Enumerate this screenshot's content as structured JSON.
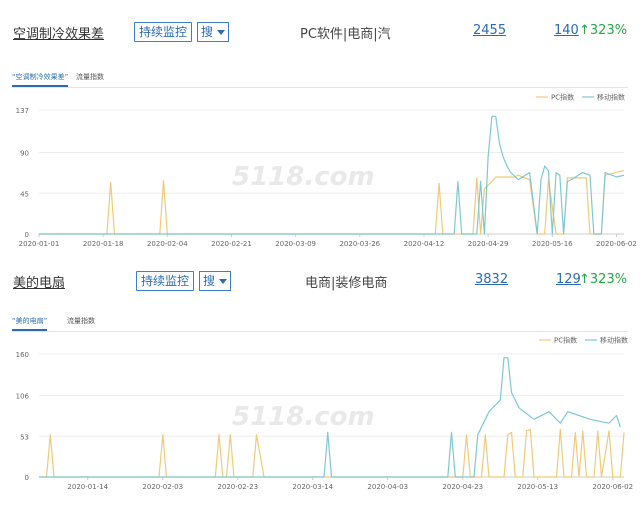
{
  "rows": [
    {
      "keyword": "空调制冷效果差",
      "monitor_label": "持续监控",
      "search_label": "搜",
      "category": "PC软件|电商|汽",
      "count": "2455",
      "rank": "140",
      "growth": "323%",
      "tab_keyword": "“空调制冷效果差”",
      "tab_metric": "流量指数"
    },
    {
      "keyword": "美的电扇",
      "monitor_label": "持续监控",
      "search_label": "搜",
      "category": "电商|装修电商",
      "count": "3832",
      "rank": "129",
      "growth": "323%",
      "tab_keyword": "“美的电扇”",
      "tab_metric": "流量指数"
    }
  ],
  "watermark": "5118.com",
  "colors": {
    "pc": "#f0c97a",
    "mobile": "#7fc8d0",
    "accent": "#2b6cb0",
    "growth": "#28a745"
  },
  "icons": {
    "growth": "arrow-up-icon",
    "search_caret": "chevron-down-icon"
  },
  "chart_data": [
    {
      "type": "line",
      "x_range": [
        "2020-01-01",
        "2020-06-04"
      ],
      "x_ticks": [
        "2020-01-01",
        "2020-01-18",
        "2020-02-04",
        "2020-02-21",
        "2020-03-09",
        "2020-03-26",
        "2020-04-12",
        "2020-04-29",
        "2020-05-16",
        "2020-06-02"
      ],
      "y_ticks": [
        "0",
        "45",
        "90",
        "137"
      ],
      "ylim": [
        0,
        137
      ],
      "legend": [
        "PC指数",
        "移动指数"
      ],
      "legend_position": "top-right",
      "grid": true,
      "series": [
        {
          "name": "PC指数",
          "color": "#f0c97a",
          "points": [
            [
              "2020-01-01",
              0
            ],
            [
              "2020-01-19",
              0
            ],
            [
              "2020-01-20",
              57
            ],
            [
              "2020-01-21",
              0
            ],
            [
              "2020-02-02",
              0
            ],
            [
              "2020-02-03",
              59
            ],
            [
              "2020-02-04",
              0
            ],
            [
              "2020-04-15",
              0
            ],
            [
              "2020-04-16",
              56
            ],
            [
              "2020-04-17",
              0
            ],
            [
              "2020-04-25",
              0
            ],
            [
              "2020-04-26",
              62
            ],
            [
              "2020-04-27",
              0
            ],
            [
              "2020-04-28",
              50
            ],
            [
              "2020-04-30",
              58
            ],
            [
              "2020-05-01",
              63
            ],
            [
              "2020-05-06",
              63
            ],
            [
              "2020-05-07",
              65
            ],
            [
              "2020-05-10",
              60
            ],
            [
              "2020-05-12",
              0
            ],
            [
              "2020-05-14",
              0
            ],
            [
              "2020-05-15",
              60
            ],
            [
              "2020-05-17",
              0
            ],
            [
              "2020-05-19",
              0
            ],
            [
              "2020-05-20",
              62
            ],
            [
              "2020-05-25",
              62
            ],
            [
              "2020-05-26",
              0
            ],
            [
              "2020-05-29",
              0
            ],
            [
              "2020-05-30",
              65
            ],
            [
              "2020-06-04",
              70
            ]
          ]
        },
        {
          "name": "移动指数",
          "color": "#7fc8d0",
          "points": [
            [
              "2020-01-01",
              0
            ],
            [
              "2020-04-20",
              0
            ],
            [
              "2020-04-21",
              58
            ],
            [
              "2020-04-22",
              0
            ],
            [
              "2020-04-26",
              0
            ],
            [
              "2020-04-27",
              58
            ],
            [
              "2020-04-28",
              0
            ],
            [
              "2020-04-29",
              85
            ],
            [
              "2020-04-30",
              130
            ],
            [
              "2020-05-01",
              130
            ],
            [
              "2020-05-02",
              100
            ],
            [
              "2020-05-03",
              85
            ],
            [
              "2020-05-04",
              75
            ],
            [
              "2020-05-05",
              68
            ],
            [
              "2020-05-07",
              60
            ],
            [
              "2020-05-10",
              68
            ],
            [
              "2020-05-12",
              0
            ],
            [
              "2020-05-13",
              60
            ],
            [
              "2020-05-14",
              75
            ],
            [
              "2020-05-15",
              70
            ],
            [
              "2020-05-16",
              0
            ],
            [
              "2020-05-17",
              68
            ],
            [
              "2020-05-18",
              65
            ],
            [
              "2020-05-19",
              0
            ],
            [
              "2020-05-20",
              58
            ],
            [
              "2020-05-21",
              60
            ],
            [
              "2020-05-24",
              68
            ],
            [
              "2020-05-26",
              65
            ],
            [
              "2020-05-27",
              0
            ],
            [
              "2020-05-29",
              0
            ],
            [
              "2020-05-30",
              68
            ],
            [
              "2020-06-02",
              63
            ],
            [
              "2020-06-04",
              65
            ]
          ]
        }
      ]
    },
    {
      "type": "line",
      "x_range": [
        "2020-01-01",
        "2020-06-05"
      ],
      "x_ticks": [
        "2020-01-14",
        "2020-02-03",
        "2020-02-23",
        "2020-03-14",
        "2020-04-03",
        "2020-04-23",
        "2020-05-13",
        "2020-06-02"
      ],
      "y_ticks": [
        "0",
        "53",
        "106",
        "160"
      ],
      "ylim": [
        0,
        160
      ],
      "legend": [
        "PC指数",
        "移动指数"
      ],
      "legend_position": "top-right",
      "grid": true,
      "series": [
        {
          "name": "PC指数",
          "color": "#f0c97a",
          "points": [
            [
              "2020-01-01",
              0
            ],
            [
              "2020-01-03",
              0
            ],
            [
              "2020-01-04",
              55
            ],
            [
              "2020-01-05",
              0
            ],
            [
              "2020-02-02",
              0
            ],
            [
              "2020-02-03",
              55
            ],
            [
              "2020-02-04",
              0
            ],
            [
              "2020-02-17",
              0
            ],
            [
              "2020-02-18",
              55
            ],
            [
              "2020-02-19",
              0
            ],
            [
              "2020-02-20",
              0
            ],
            [
              "2020-02-21",
              55
            ],
            [
              "2020-02-22",
              0
            ],
            [
              "2020-02-27",
              0
            ],
            [
              "2020-02-28",
              55
            ],
            [
              "2020-03-01",
              0
            ],
            [
              "2020-04-23",
              0
            ],
            [
              "2020-04-24",
              55
            ],
            [
              "2020-04-25",
              0
            ],
            [
              "2020-04-28",
              0
            ],
            [
              "2020-04-29",
              55
            ],
            [
              "2020-04-30",
              0
            ],
            [
              "2020-05-04",
              0
            ],
            [
              "2020-05-05",
              55
            ],
            [
              "2020-05-06",
              58
            ],
            [
              "2020-05-07",
              0
            ],
            [
              "2020-05-09",
              0
            ],
            [
              "2020-05-10",
              60
            ],
            [
              "2020-05-11",
              62
            ],
            [
              "2020-05-12",
              0
            ],
            [
              "2020-05-18",
              0
            ],
            [
              "2020-05-19",
              62
            ],
            [
              "2020-05-20",
              0
            ],
            [
              "2020-05-22",
              0
            ],
            [
              "2020-05-23",
              58
            ],
            [
              "2020-05-24",
              0
            ],
            [
              "2020-05-25",
              60
            ],
            [
              "2020-05-26",
              0
            ],
            [
              "2020-05-28",
              0
            ],
            [
              "2020-05-29",
              60
            ],
            [
              "2020-05-30",
              0
            ],
            [
              "2020-06-01",
              60
            ],
            [
              "2020-06-02",
              0
            ],
            [
              "2020-06-04",
              0
            ],
            [
              "2020-06-05",
              58
            ]
          ]
        },
        {
          "name": "移动指数",
          "color": "#7fc8d0",
          "points": [
            [
              "2020-01-01",
              0
            ],
            [
              "2020-03-17",
              0
            ],
            [
              "2020-03-18",
              58
            ],
            [
              "2020-03-19",
              0
            ],
            [
              "2020-04-19",
              0
            ],
            [
              "2020-04-20",
              58
            ],
            [
              "2020-04-21",
              0
            ],
            [
              "2020-04-26",
              0
            ],
            [
              "2020-04-27",
              55
            ],
            [
              "2020-04-30",
              85
            ],
            [
              "2020-05-03",
              100
            ],
            [
              "2020-05-04",
              155
            ],
            [
              "2020-05-05",
              155
            ],
            [
              "2020-05-06",
              110
            ],
            [
              "2020-05-08",
              90
            ],
            [
              "2020-05-12",
              75
            ],
            [
              "2020-05-16",
              85
            ],
            [
              "2020-05-19",
              70
            ],
            [
              "2020-05-21",
              85
            ],
            [
              "2020-05-24",
              80
            ],
            [
              "2020-05-27",
              75
            ],
            [
              "2020-06-01",
              70
            ],
            [
              "2020-06-03",
              80
            ],
            [
              "2020-06-04",
              65
            ]
          ]
        }
      ]
    }
  ]
}
